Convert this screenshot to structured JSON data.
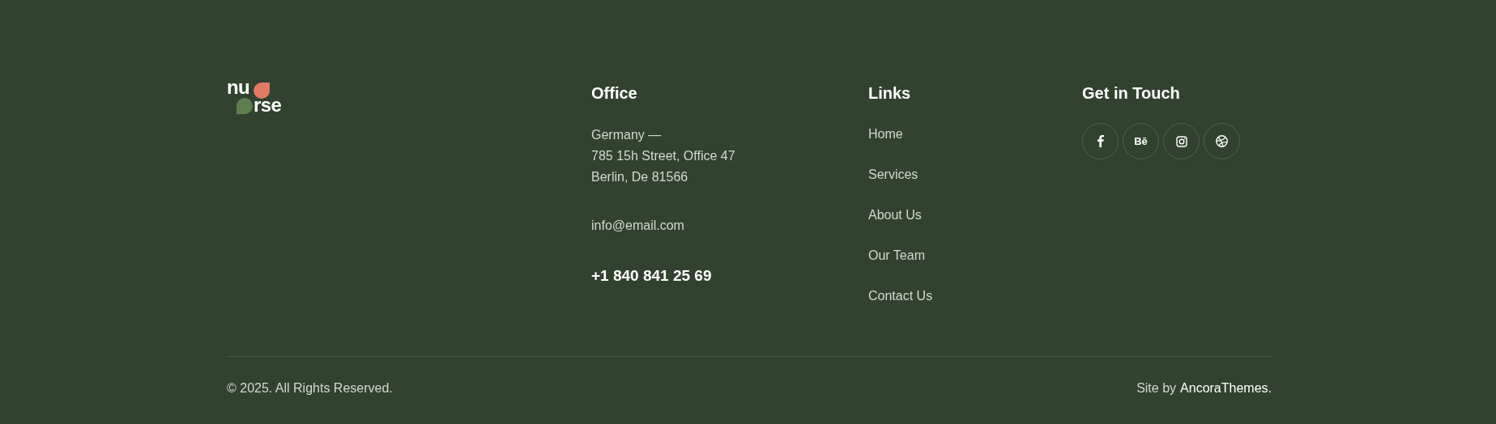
{
  "logo": {
    "top": "nu",
    "bottom": "rse"
  },
  "office": {
    "title": "Office",
    "address": [
      "Germany —",
      "785 15h Street, Office 47",
      "Berlin, De 81566"
    ],
    "email": "info@email.com",
    "phone": "+1 840 841 25 69"
  },
  "links": {
    "title": "Links",
    "items": [
      "Home",
      "Services",
      "About Us",
      "Our Team",
      "Contact Us"
    ]
  },
  "contact": {
    "title": "Get in Touch",
    "socials": [
      {
        "kind": "facebook"
      },
      {
        "kind": "behance",
        "label": "Bē"
      },
      {
        "kind": "instagram"
      },
      {
        "kind": "dribbble"
      }
    ]
  },
  "footer": {
    "copyright": "© 2025. All Rights Reserved.",
    "credit_prefix": "Site by",
    "credit_link": "AncoraThemes."
  }
}
